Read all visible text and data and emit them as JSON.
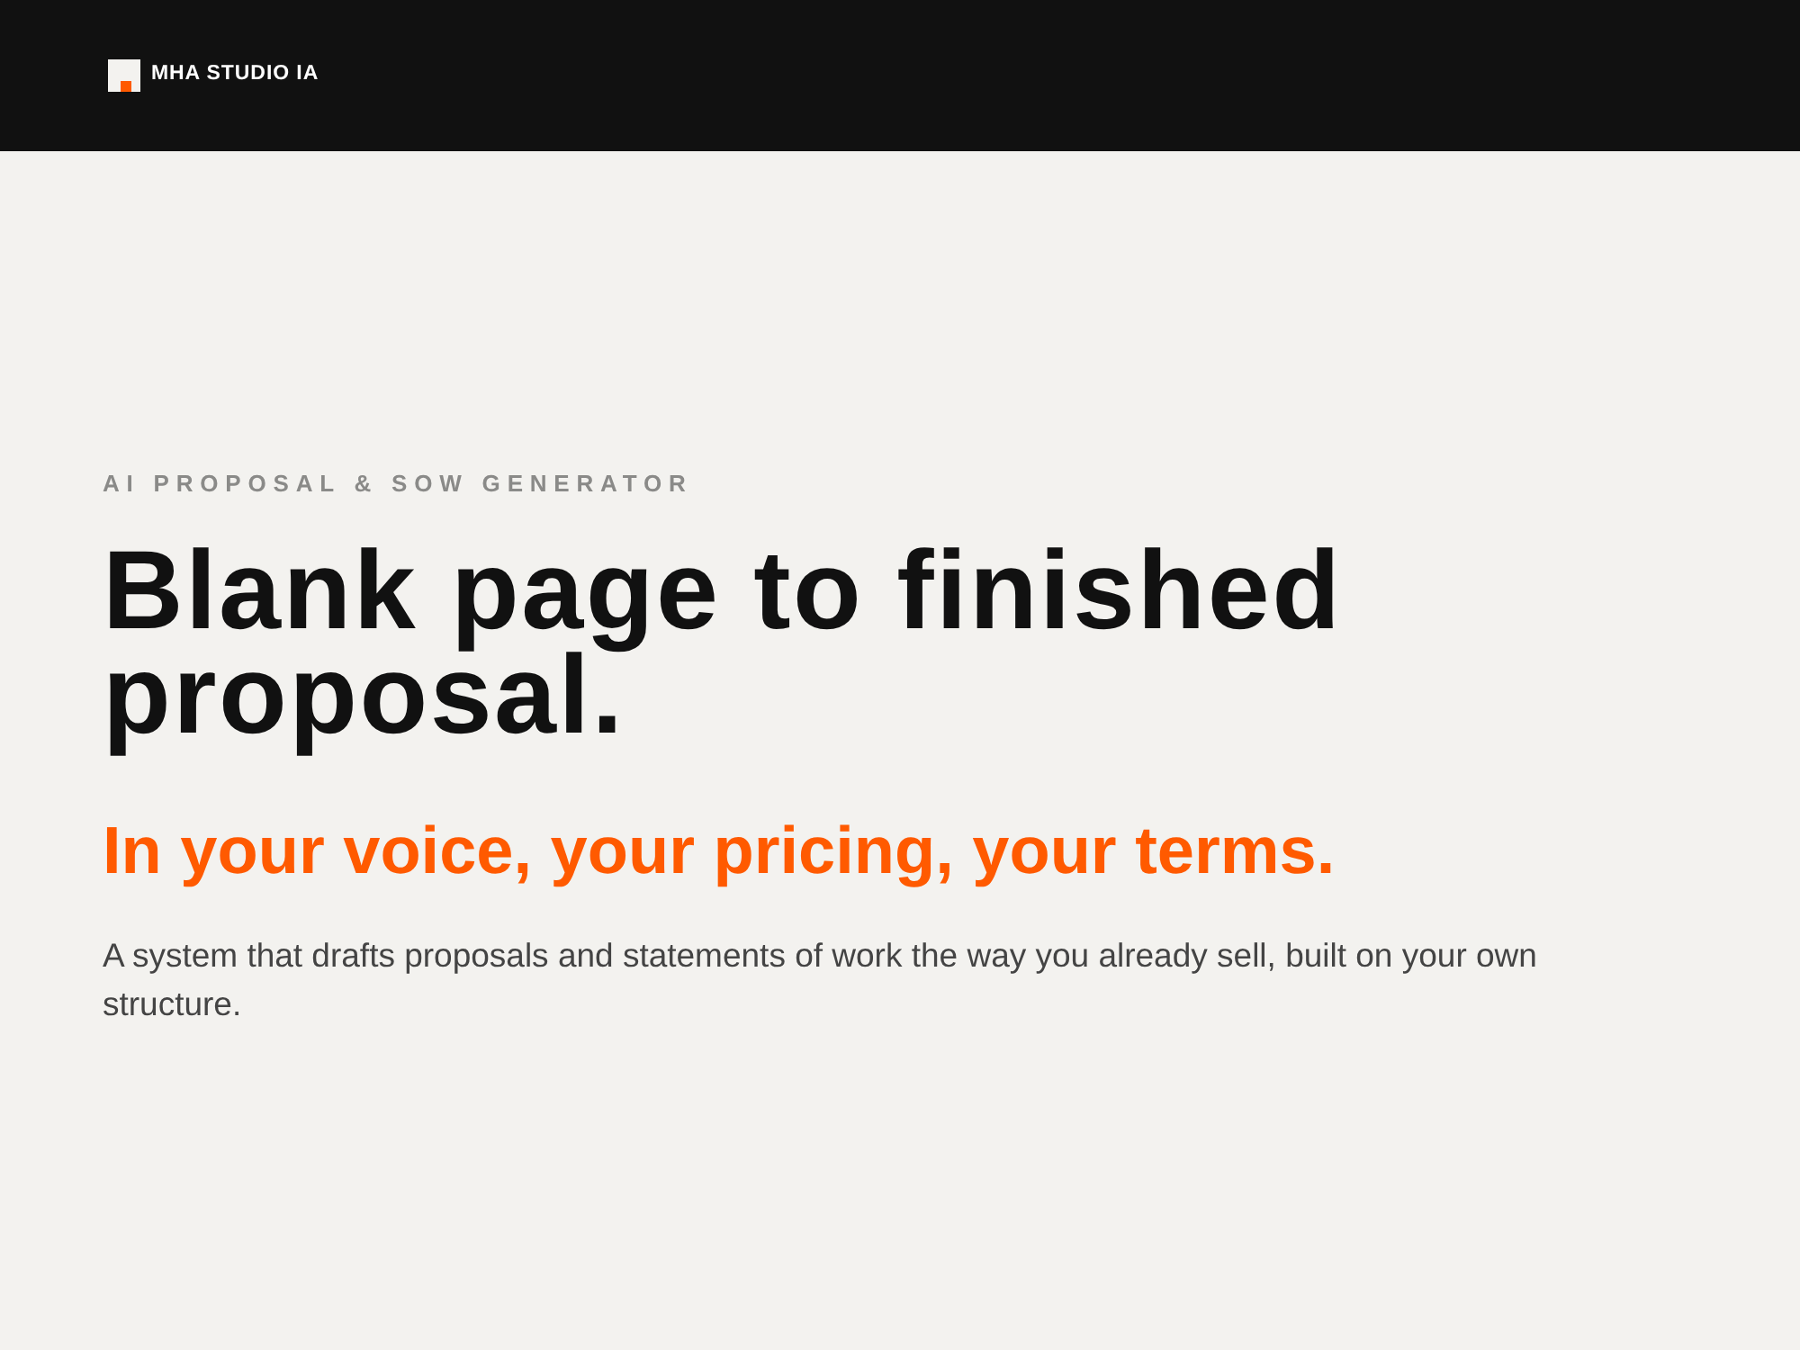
{
  "header": {
    "brand": "MHA STUDIO IA"
  },
  "hero": {
    "eyebrow": "AI PROPOSAL & SOW GENERATOR",
    "headline": "Blank page to finished proposal.",
    "tagline": "In your voice, your pricing, your terms.",
    "description": "A system that drafts proposals and statements of work the way you already sell, built on your own structure."
  }
}
